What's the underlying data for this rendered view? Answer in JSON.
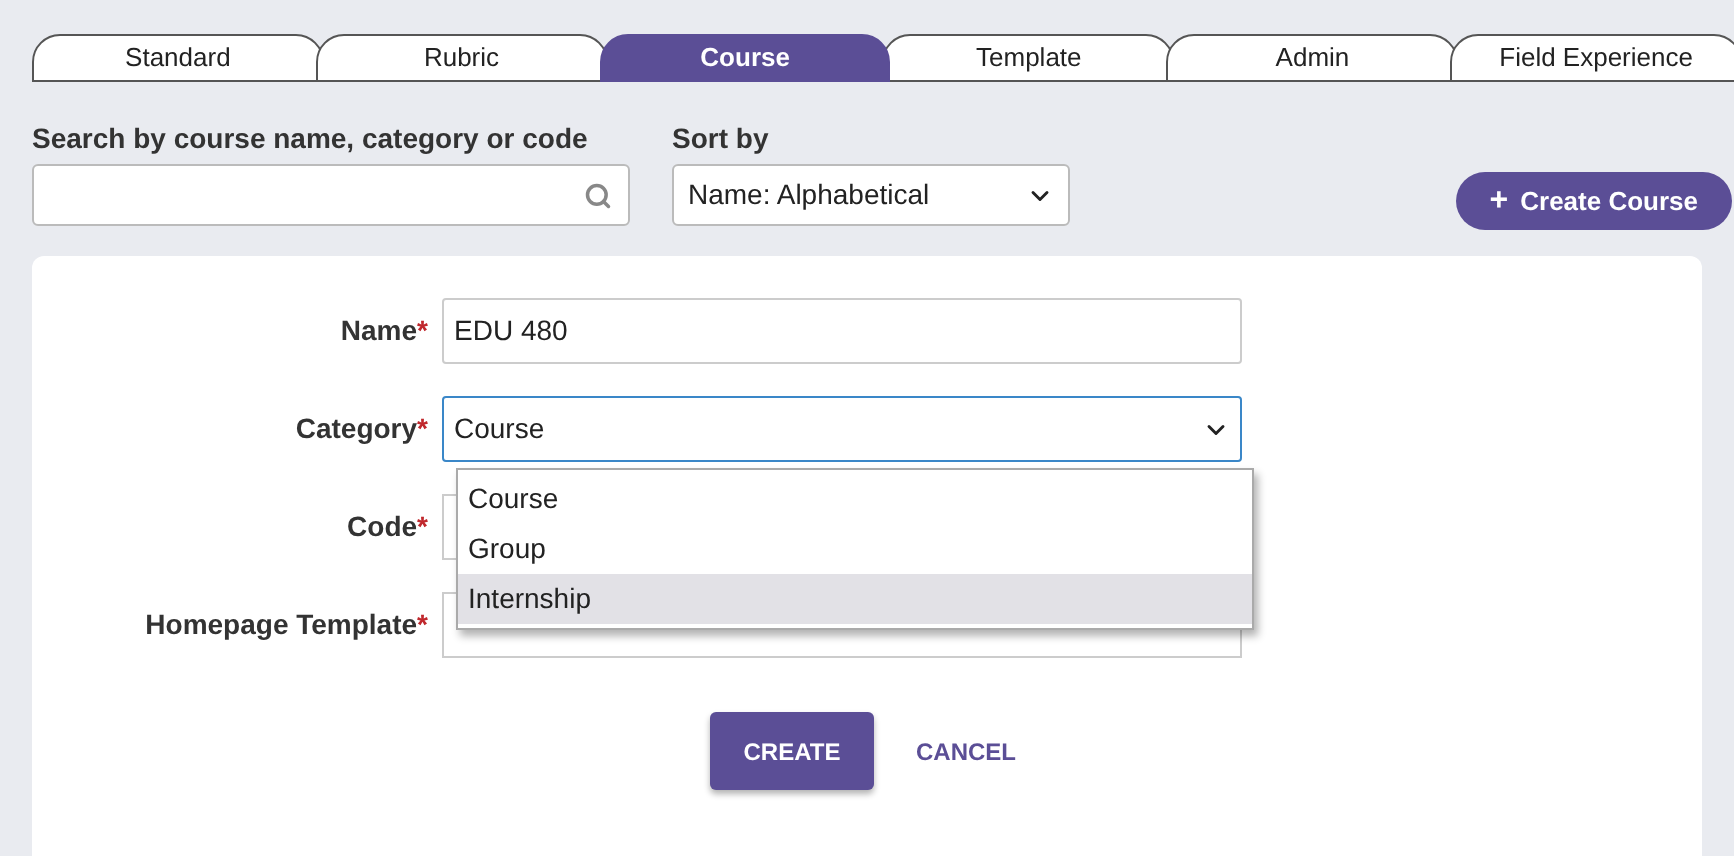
{
  "tabs": [
    {
      "label": "Standard",
      "selected": false
    },
    {
      "label": "Rubric",
      "selected": false
    },
    {
      "label": "Course",
      "selected": true
    },
    {
      "label": "Template",
      "selected": false
    },
    {
      "label": "Admin",
      "selected": false
    },
    {
      "label": "Field Experience",
      "selected": false
    }
  ],
  "search": {
    "label": "Search by course name, category or code"
  },
  "sort": {
    "label": "Sort by",
    "value": "Name: Alphabetical"
  },
  "create_course_button": {
    "icon": "+",
    "label": "Create Course"
  },
  "form": {
    "fields": [
      {
        "label": "Name",
        "required": "*",
        "value": "EDU 480",
        "focused": false
      },
      {
        "label": "Category",
        "required": "*",
        "value": "Course",
        "focused": true,
        "kind": "select"
      },
      {
        "label": "Code",
        "required": "*"
      },
      {
        "label": "Homepage Template",
        "required": "*"
      }
    ],
    "dropdown": [
      {
        "label": "Course",
        "selected": false
      },
      {
        "label": "Group",
        "selected": false
      },
      {
        "label": "Internship",
        "selected": true
      }
    ],
    "buttons": {
      "create": "CREATE",
      "cancel": "CANCEL"
    }
  }
}
